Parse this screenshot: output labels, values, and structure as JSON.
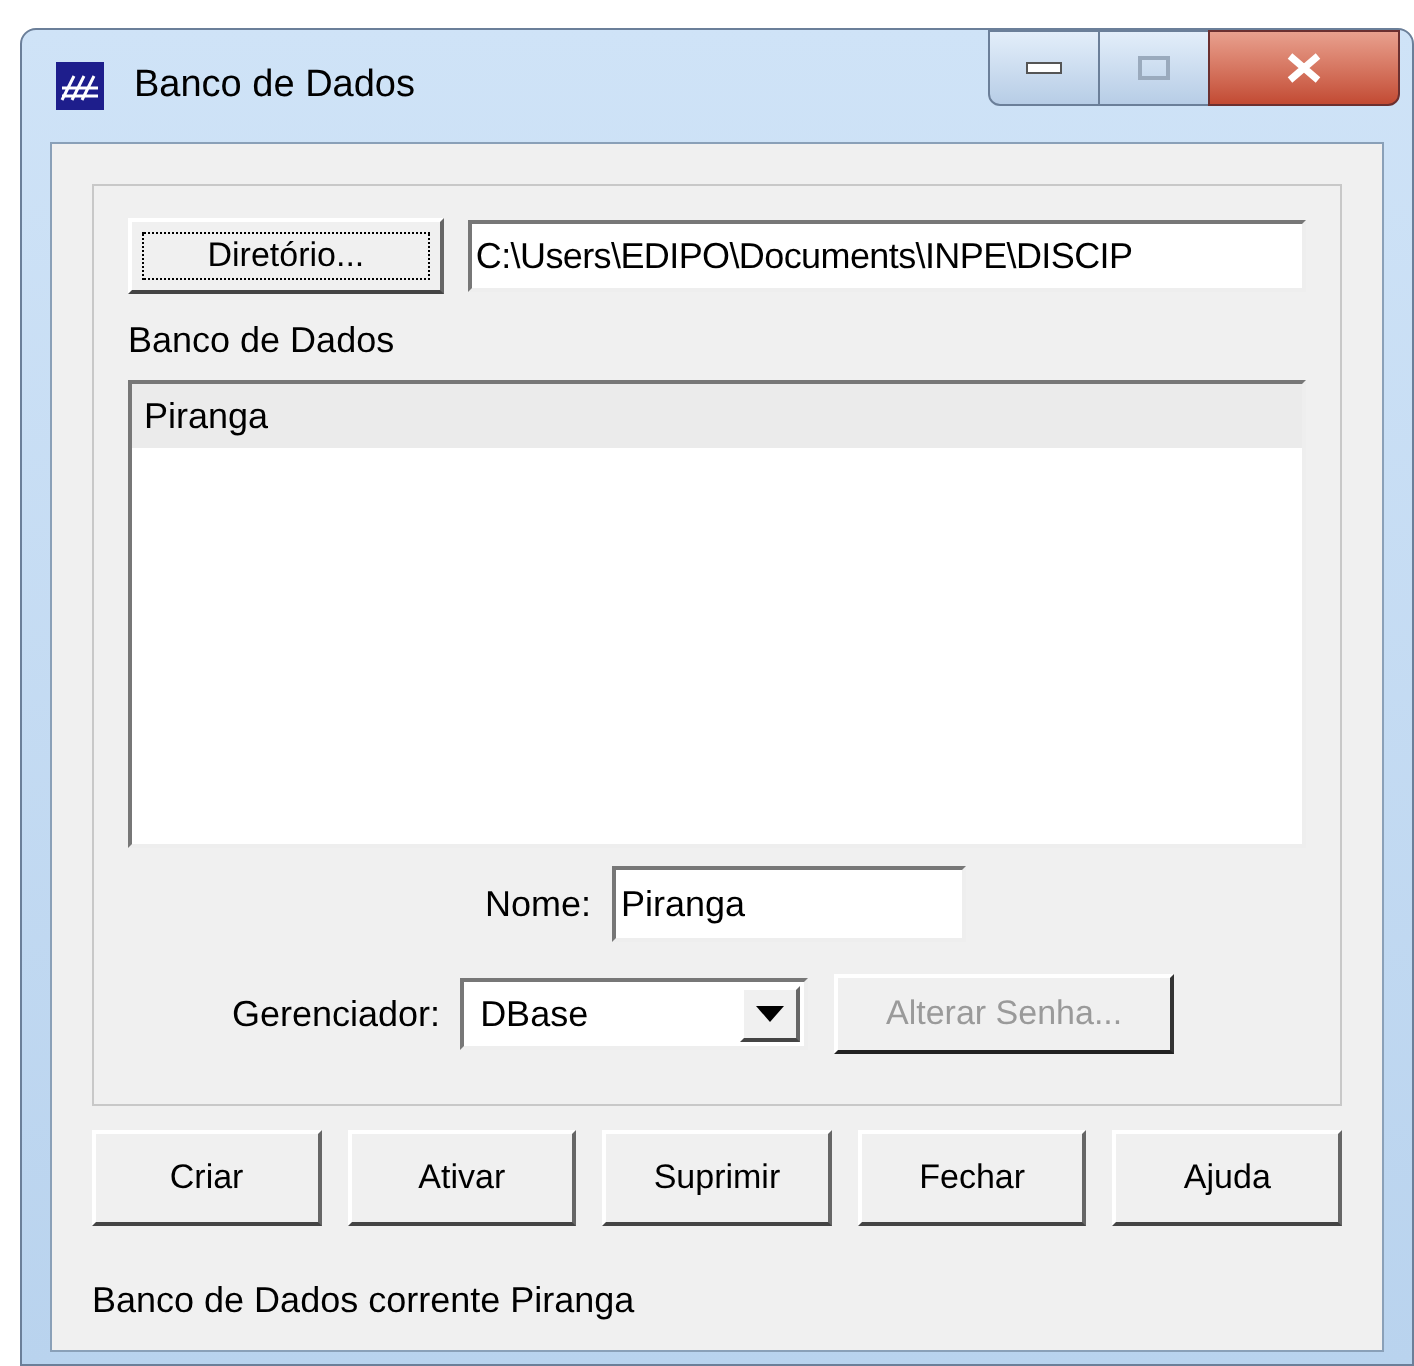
{
  "window": {
    "title": "Banco de Dados"
  },
  "directory_button": {
    "label": "Diretório..."
  },
  "path_field": {
    "value": "C:\\Users\\EDIPO\\Documents\\INPE\\DISCIP"
  },
  "list_label": "Banco de Dados",
  "databases": [
    {
      "label": "Piranga",
      "selected": true
    }
  ],
  "name_field": {
    "label": "Nome:",
    "value": "Piranga"
  },
  "manager": {
    "label": "Gerenciador:",
    "value": "DBase"
  },
  "change_password": {
    "label": "Alterar Senha...",
    "disabled": true
  },
  "buttons": [
    {
      "label": "Criar"
    },
    {
      "label": "Ativar"
    },
    {
      "label": "Suprimir"
    },
    {
      "label": "Fechar"
    },
    {
      "label": "Ajuda"
    }
  ],
  "status_bar": "Banco de Dados corrente Piranga"
}
